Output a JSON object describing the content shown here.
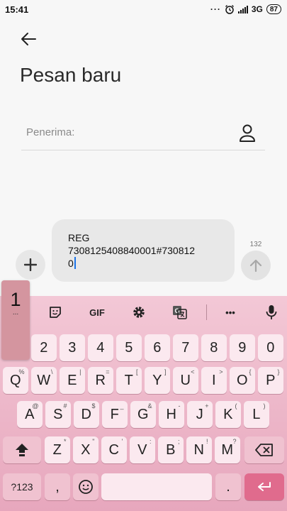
{
  "status": {
    "time": "15:41",
    "dots": "···",
    "network": "3G",
    "battery": "87"
  },
  "header": {
    "title": "Pesan baru"
  },
  "recipient": {
    "placeholder": "Penerima:"
  },
  "compose": {
    "line1": "REG",
    "line2": "7308125408840001#730812",
    "line3": "0",
    "counter": "132"
  },
  "popup": {
    "key": "1",
    "more": "..."
  },
  "toolbar": {
    "gif": "GIF",
    "more": "•••"
  },
  "keys": {
    "row_numbers": [
      "1",
      "2",
      "3",
      "4",
      "5",
      "6",
      "7",
      "8",
      "9",
      "0"
    ],
    "row_q": [
      {
        "label": "Q",
        "hint": "%"
      },
      {
        "label": "W",
        "hint": "\\"
      },
      {
        "label": "E",
        "hint": "|"
      },
      {
        "label": "R",
        "hint": "="
      },
      {
        "label": "T",
        "hint": "["
      },
      {
        "label": "Y",
        "hint": "]"
      },
      {
        "label": "U",
        "hint": "<"
      },
      {
        "label": "I",
        "hint": ">"
      },
      {
        "label": "O",
        "hint": "{"
      },
      {
        "label": "P",
        "hint": "}"
      }
    ],
    "row_a": [
      {
        "label": "A",
        "hint": "@"
      },
      {
        "label": "S",
        "hint": "#"
      },
      {
        "label": "D",
        "hint": "$"
      },
      {
        "label": "F",
        "hint": "_"
      },
      {
        "label": "G",
        "hint": "&"
      },
      {
        "label": "H",
        "hint": "-"
      },
      {
        "label": "J",
        "hint": "+"
      },
      {
        "label": "K",
        "hint": "("
      },
      {
        "label": "L",
        "hint": ")"
      }
    ],
    "row_z": [
      {
        "label": "Z",
        "hint": "*"
      },
      {
        "label": "X",
        "hint": "\""
      },
      {
        "label": "C",
        "hint": "'"
      },
      {
        "label": "V",
        "hint": ":"
      },
      {
        "label": "B",
        "hint": ";"
      },
      {
        "label": "N",
        "hint": "!"
      },
      {
        "label": "M",
        "hint": "?"
      }
    ],
    "symbols": "?123",
    "comma": ",",
    "period": "."
  }
}
